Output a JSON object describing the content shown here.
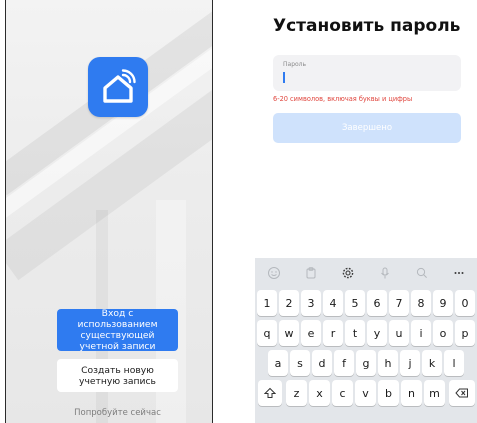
{
  "left": {
    "login_button": "Вход с использованием существующей учетной записи",
    "register_button": "Создать новую учетную запись",
    "try_link": "Попробуйте сейчас"
  },
  "right": {
    "title": "Установить пароль",
    "password_label": "Пароль",
    "password_value": "",
    "hint": "6-20 символов, включая буквы и цифры",
    "done_button": "Завершено"
  },
  "keyboard": {
    "toolbar": [
      "emoji-icon",
      "clipboard-icon",
      "gear-icon",
      "microphone-icon",
      "search-icon",
      "more-icon"
    ],
    "row_numbers": [
      "1",
      "2",
      "3",
      "4",
      "5",
      "6",
      "7",
      "8",
      "9",
      "0"
    ],
    "row_1": [
      "q",
      "w",
      "e",
      "r",
      "t",
      "y",
      "u",
      "i",
      "o",
      "p"
    ],
    "row_2": [
      "a",
      "s",
      "d",
      "f",
      "g",
      "h",
      "j",
      "k",
      "l"
    ],
    "row_3": [
      "z",
      "x",
      "c",
      "v",
      "b",
      "n",
      "m"
    ]
  },
  "colors": {
    "accent": "#2f7bf0",
    "done_disabled": "#cfe2fc",
    "hint": "#e0453d"
  }
}
